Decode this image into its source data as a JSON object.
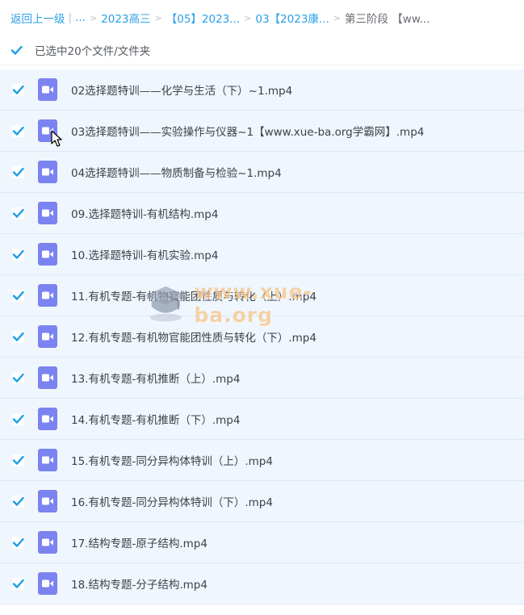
{
  "breadcrumb": {
    "back_label": "返回上一级",
    "separator": "|",
    "ellipsis": "...",
    "arrow": ">",
    "items": [
      "2023高三",
      "【05】2023...",
      "03【2023康...",
      "第三阶段 【ww..."
    ]
  },
  "selection": {
    "label": "已选中20个文件/文件夹",
    "checked": true
  },
  "icon_names": {
    "checkbox": "checkbox-checked-icon",
    "file": "video-file-icon",
    "cursor": "mouse-cursor-icon",
    "watermark_logo": "graduation-cap-icon"
  },
  "colors": {
    "accent": "#2aa0e6",
    "row_bg": "#f0f6fd",
    "file_icon": "#7b83f0"
  },
  "files": [
    {
      "name": "02选择题特训——化学与生活（下）~1.mp4",
      "checked": true
    },
    {
      "name": "03选择题特训——实验操作与仪器~1【www.xue-ba.org学霸网】.mp4",
      "checked": true
    },
    {
      "name": "04选择题特训——物质制备与检验~1.mp4",
      "checked": true
    },
    {
      "name": "09.选择题特训-有机结构.mp4",
      "checked": true
    },
    {
      "name": "10.选择题特训-有机实验.mp4",
      "checked": true
    },
    {
      "name": "11.有机专题-有机物官能团性质与转化（上）.mp4",
      "checked": true
    },
    {
      "name": "12.有机专题-有机物官能团性质与转化（下）.mp4",
      "checked": true
    },
    {
      "name": "13.有机专题-有机推断（上）.mp4",
      "checked": true
    },
    {
      "name": "14.有机专题-有机推断（下）.mp4",
      "checked": true
    },
    {
      "name": "15.有机专题-同分异构体特训（上）.mp4",
      "checked": true
    },
    {
      "name": "16.有机专题-同分异构体特训（下）.mp4",
      "checked": true
    },
    {
      "name": "17.结构专题-原子结构.mp4",
      "checked": true
    },
    {
      "name": "18.结构专题-分子结构.mp4",
      "checked": true
    }
  ],
  "watermark": {
    "text": "www.xue-ba.org"
  }
}
